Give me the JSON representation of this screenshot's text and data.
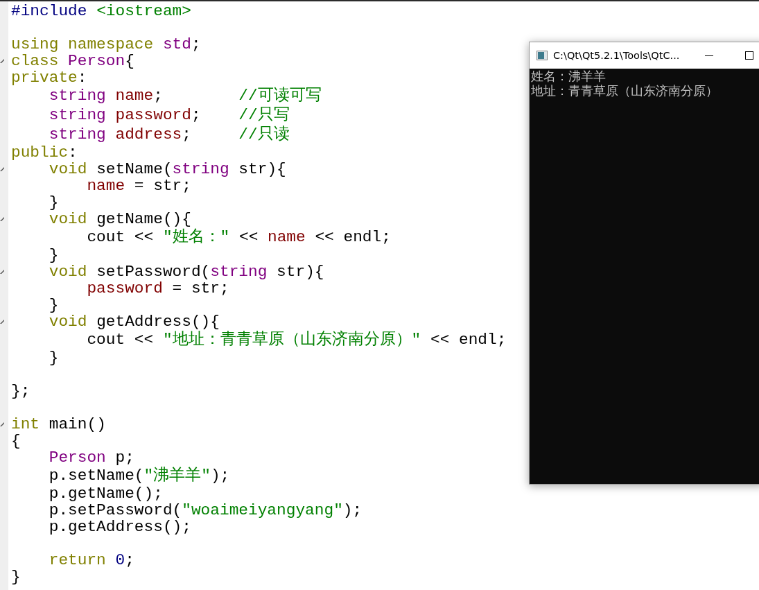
{
  "editor": {
    "lines": [
      {
        "fold": false,
        "tokens": [
          {
            "text": "#include ",
            "kind": "pre"
          },
          {
            "text": "<iostream>",
            "kind": "str"
          }
        ]
      },
      {
        "fold": false
      },
      {
        "fold": false,
        "tokens": [
          {
            "text": "using namespace ",
            "kind": "kw"
          },
          {
            "text": "std",
            "kind": "type"
          },
          {
            "text": ";",
            "kind": "plain"
          }
        ]
      },
      {
        "fold": true,
        "tokens": [
          {
            "text": "class ",
            "kind": "kw"
          },
          {
            "text": "Person",
            "kind": "type"
          },
          {
            "text": "{",
            "kind": "plain"
          }
        ]
      },
      {
        "fold": false,
        "tokens": [
          {
            "text": "private",
            "kind": "kw"
          },
          {
            "text": ":",
            "kind": "plain"
          }
        ]
      },
      {
        "fold": false,
        "tokens": [
          {
            "text": "    string ",
            "kind": "type"
          },
          {
            "text": "name",
            "kind": "var"
          },
          {
            "text": ";        ",
            "kind": "plain"
          },
          {
            "text": "//可读可写",
            "kind": "comment"
          }
        ]
      },
      {
        "fold": false,
        "tokens": [
          {
            "text": "    string ",
            "kind": "type"
          },
          {
            "text": "password",
            "kind": "var"
          },
          {
            "text": ";    ",
            "kind": "plain"
          },
          {
            "text": "//只写",
            "kind": "comment"
          }
        ]
      },
      {
        "fold": false,
        "tokens": [
          {
            "text": "    string ",
            "kind": "type"
          },
          {
            "text": "address",
            "kind": "var"
          },
          {
            "text": ";     ",
            "kind": "plain"
          },
          {
            "text": "//只读",
            "kind": "comment"
          }
        ]
      },
      {
        "fold": false,
        "tokens": [
          {
            "text": "public",
            "kind": "kw"
          },
          {
            "text": ":",
            "kind": "plain"
          }
        ]
      },
      {
        "fold": true,
        "tokens": [
          {
            "text": "    void",
            "kind": "kw"
          },
          {
            "text": " setName(",
            "kind": "plain"
          },
          {
            "text": "string",
            "kind": "type"
          },
          {
            "text": " str){",
            "kind": "plain"
          }
        ]
      },
      {
        "fold": false,
        "tokens": [
          {
            "text": "        name",
            "kind": "var"
          },
          {
            "text": " = str;",
            "kind": "plain"
          }
        ]
      },
      {
        "fold": false,
        "tokens": [
          {
            "text": "    }",
            "kind": "plain"
          }
        ]
      },
      {
        "fold": true,
        "tokens": [
          {
            "text": "    void",
            "kind": "kw"
          },
          {
            "text": " getName(){",
            "kind": "plain"
          }
        ]
      },
      {
        "fold": false,
        "tokens": [
          {
            "text": "        cout << ",
            "kind": "plain"
          },
          {
            "text": "\"姓名：\"",
            "kind": "str"
          },
          {
            "text": " << ",
            "kind": "plain"
          },
          {
            "text": "name",
            "kind": "var"
          },
          {
            "text": " << endl;",
            "kind": "plain"
          }
        ]
      },
      {
        "fold": false,
        "tokens": [
          {
            "text": "    }",
            "kind": "plain"
          }
        ]
      },
      {
        "fold": true,
        "tokens": [
          {
            "text": "    void",
            "kind": "kw"
          },
          {
            "text": " setPassword(",
            "kind": "plain"
          },
          {
            "text": "string",
            "kind": "type"
          },
          {
            "text": " str){",
            "kind": "plain"
          }
        ]
      },
      {
        "fold": false,
        "tokens": [
          {
            "text": "        password",
            "kind": "var"
          },
          {
            "text": " = str;",
            "kind": "plain"
          }
        ]
      },
      {
        "fold": false,
        "tokens": [
          {
            "text": "    }",
            "kind": "plain"
          }
        ]
      },
      {
        "fold": true,
        "tokens": [
          {
            "text": "    void",
            "kind": "kw"
          },
          {
            "text": " getAddress(){",
            "kind": "plain"
          }
        ]
      },
      {
        "fold": false,
        "tokens": [
          {
            "text": "        cout << ",
            "kind": "plain"
          },
          {
            "text": "\"地址：青青草原（山东济南分原）\"",
            "kind": "str"
          },
          {
            "text": " << endl;",
            "kind": "plain"
          }
        ]
      },
      {
        "fold": false,
        "tokens": [
          {
            "text": "    }",
            "kind": "plain"
          }
        ]
      },
      {
        "fold": false
      },
      {
        "fold": false,
        "tokens": [
          {
            "text": "};",
            "kind": "plain"
          }
        ]
      },
      {
        "fold": false
      },
      {
        "fold": true,
        "tokens": [
          {
            "text": "int",
            "kind": "kw"
          },
          {
            "text": " main()",
            "kind": "plain"
          }
        ]
      },
      {
        "fold": false,
        "tokens": [
          {
            "text": "{",
            "kind": "plain"
          }
        ]
      },
      {
        "fold": false,
        "tokens": [
          {
            "text": "    Person",
            "kind": "type"
          },
          {
            "text": " p;",
            "kind": "plain"
          }
        ]
      },
      {
        "fold": false,
        "tokens": [
          {
            "text": "    p.setName(",
            "kind": "plain"
          },
          {
            "text": "\"沸羊羊\"",
            "kind": "str"
          },
          {
            "text": ");",
            "kind": "plain"
          }
        ]
      },
      {
        "fold": false,
        "tokens": [
          {
            "text": "    p.getName();",
            "kind": "plain"
          }
        ]
      },
      {
        "fold": false,
        "tokens": [
          {
            "text": "    p.setPassword(",
            "kind": "plain"
          },
          {
            "text": "\"woaimeiyangyang\"",
            "kind": "str"
          },
          {
            "text": ");",
            "kind": "plain"
          }
        ]
      },
      {
        "fold": false,
        "tokens": [
          {
            "text": "    p.getAddress();",
            "kind": "plain"
          }
        ]
      },
      {
        "fold": false
      },
      {
        "fold": false,
        "tokens": [
          {
            "text": "    return ",
            "kind": "kw"
          },
          {
            "text": "0",
            "kind": "num"
          },
          {
            "text": ";",
            "kind": "plain"
          }
        ]
      },
      {
        "fold": false,
        "tokens": [
          {
            "text": "}",
            "kind": "plain"
          }
        ]
      }
    ]
  },
  "console": {
    "title": "C:\\Qt\\Qt5.2.1\\Tools\\QtC...",
    "lines": [
      "姓名：沸羊羊",
      "地址：青青草原（山东济南分原）"
    ]
  }
}
